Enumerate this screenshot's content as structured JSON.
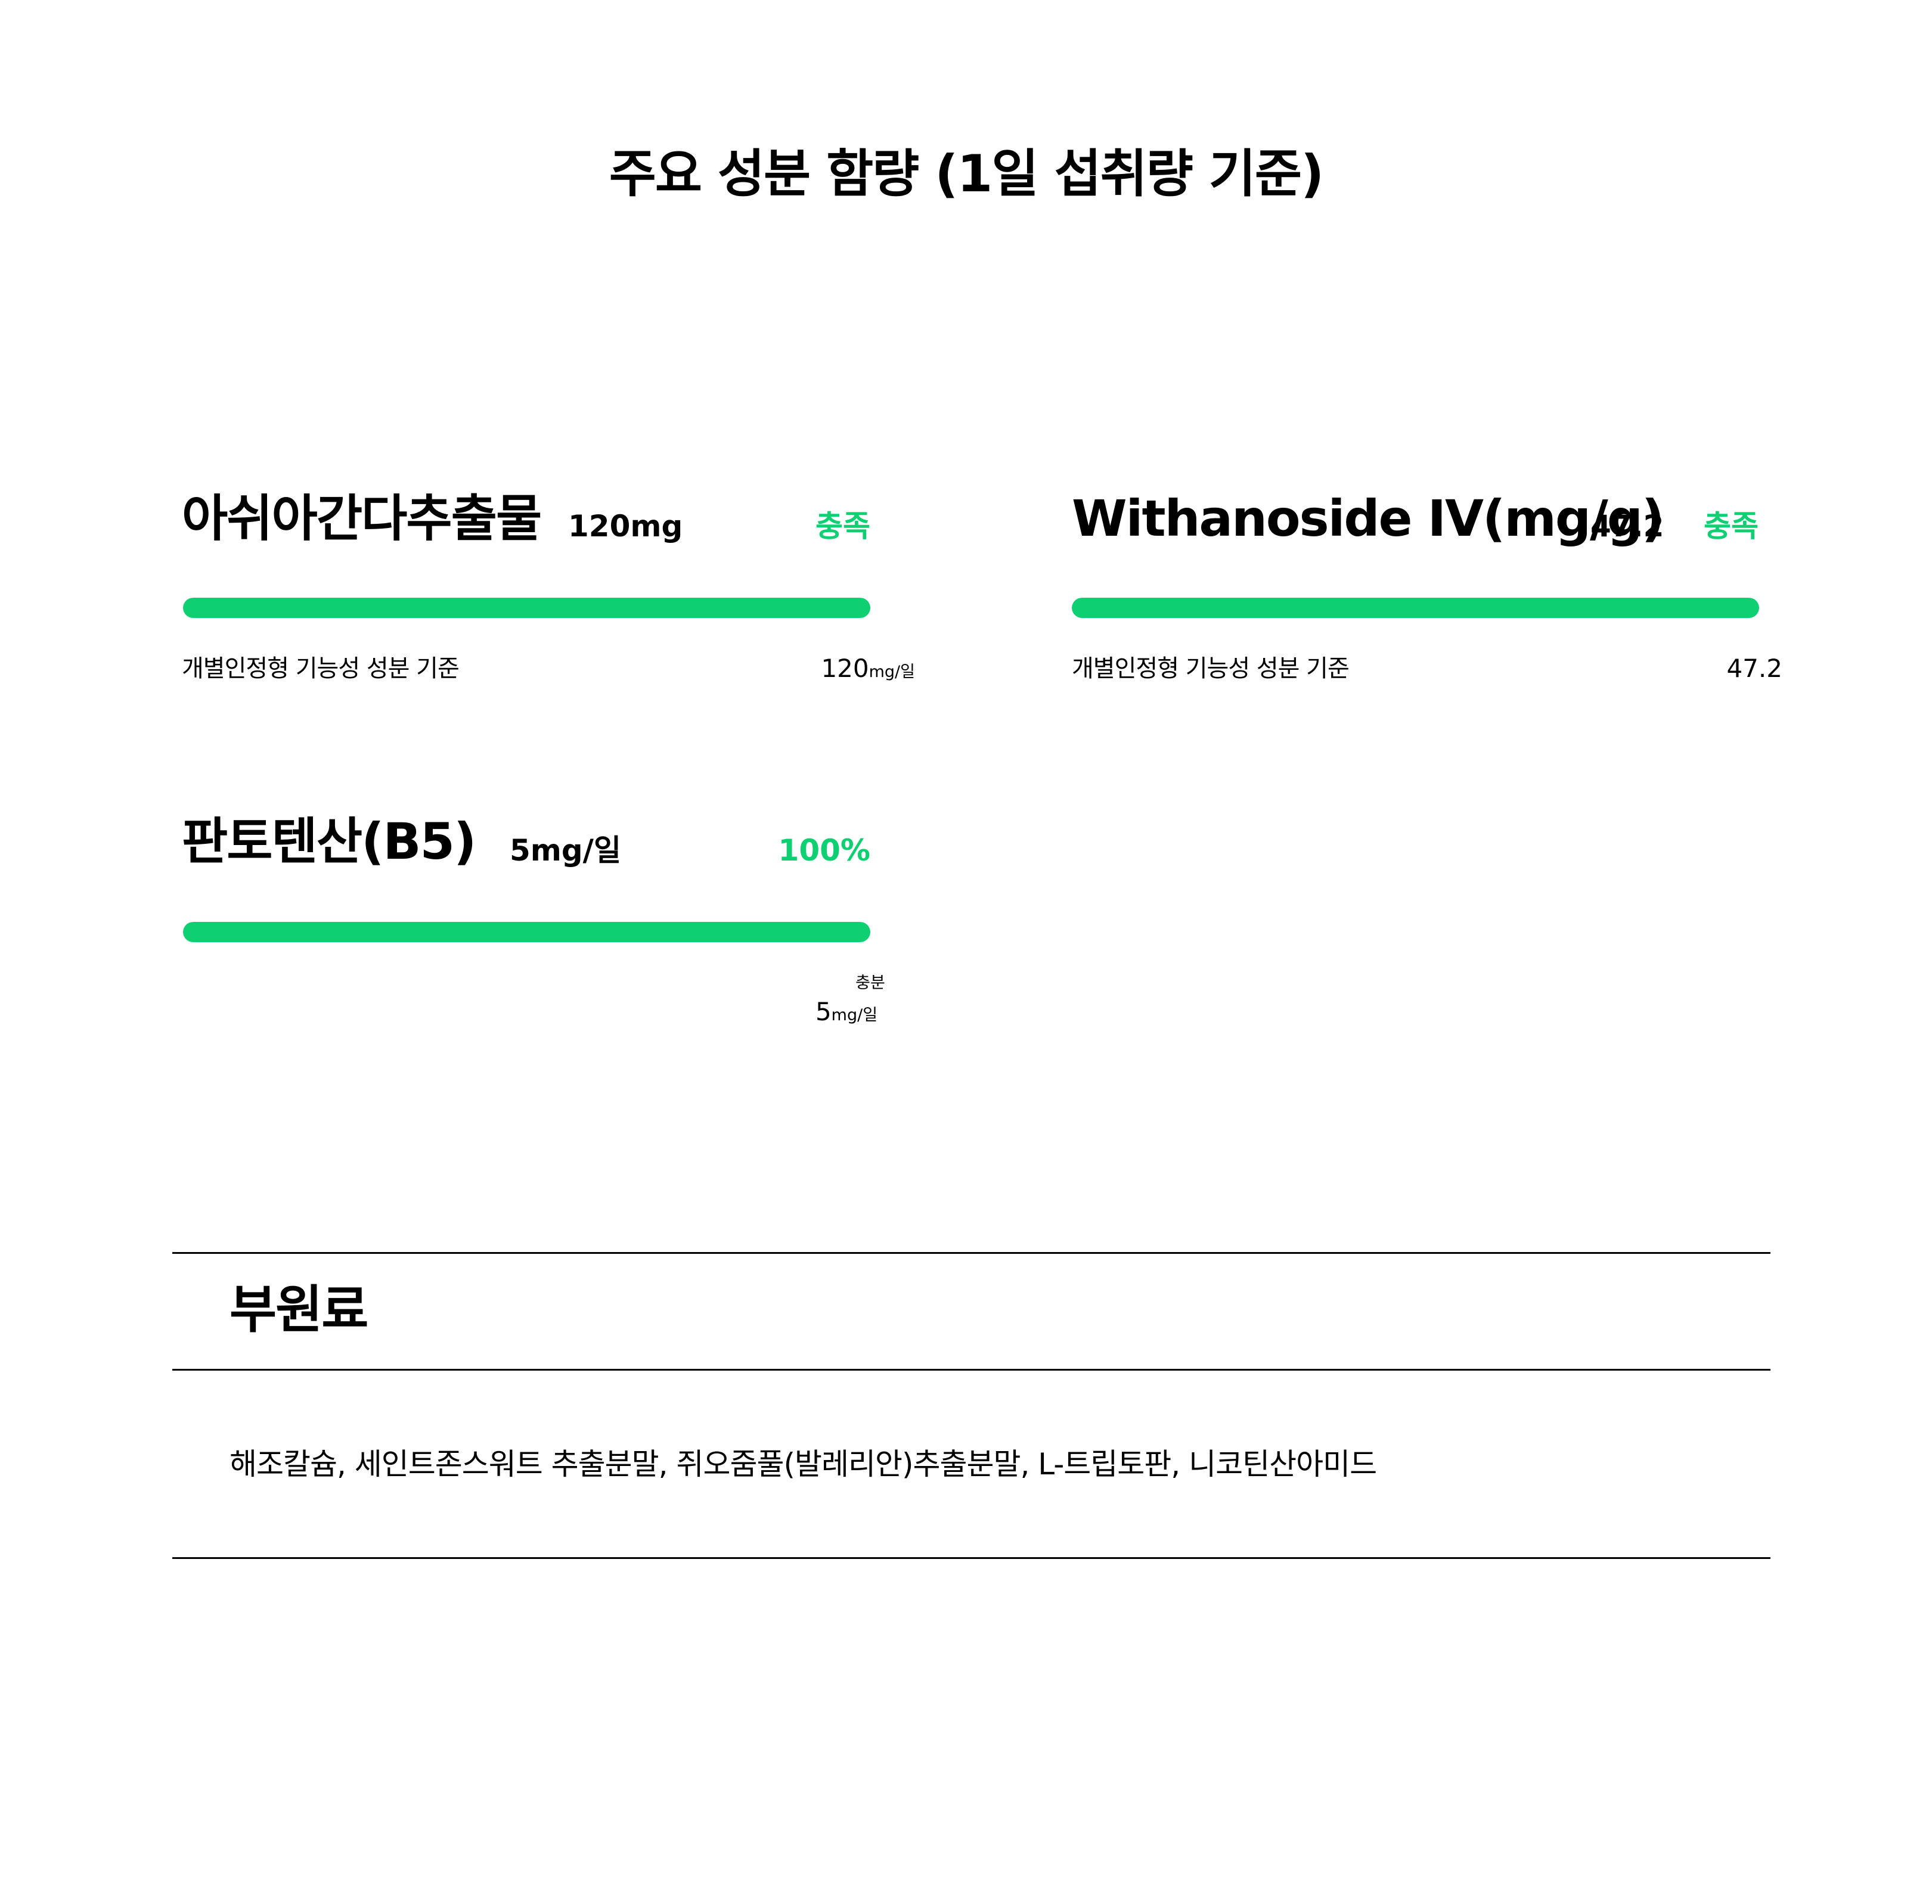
{
  "title": "주요 성분 함량 (1일 섭취량 기준)",
  "colors": {
    "accent": "#0ecf72",
    "text": "#000000",
    "background": "#ffffff"
  },
  "ingredients": [
    {
      "name": "아쉬아간다추출물",
      "amount": "120mg",
      "status": "충족",
      "fill_fraction": 1.0,
      "caption": "개별인정형 기능성 성분 기준",
      "value": "120",
      "value_unit": "mg/일"
    },
    {
      "name": "Withanoside IV(mg/g)",
      "amount": "47.2",
      "status": "충족",
      "fill_fraction": 1.0,
      "caption": "개별인정형 기능성 성분 기준",
      "value": "47.2"
    },
    {
      "name": "판토텐산(B5)",
      "amount": "5mg/일",
      "status": "100%",
      "fill_fraction": 1.0,
      "small_label": "충분",
      "value": "5",
      "value_unit": "mg/일"
    }
  ],
  "sub_ingredients": {
    "heading": "부원료",
    "list": "해조칼슘, 세인트존스워트 추출분말, 쥐오줌풀(발레리안)추출분말, L-트립토판, 니코틴산아미드"
  }
}
